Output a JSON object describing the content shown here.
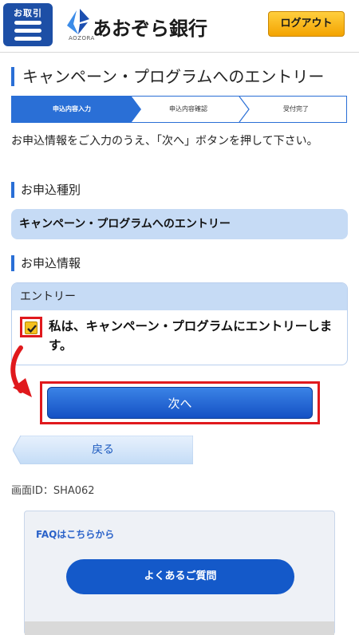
{
  "header": {
    "menu_label": "お取引",
    "bank_name": "あおぞら銀行",
    "bank_sub": "AOZORA",
    "logout_label": "ログアウト"
  },
  "page_title": "キャンペーン・プログラムへのエントリー",
  "steps": [
    "申込内容入力",
    "申込内容確認",
    "受付完了"
  ],
  "intro_text": "お申込情報をご入力のうえ、「次へ」ボタンを押して下さい。",
  "section_type": {
    "title": "お申込種別",
    "value": "キャンペーン・プログラムへのエントリー"
  },
  "section_info": {
    "title": "お申込情報",
    "card_header": "エントリー",
    "checkbox_label": "私は、キャンペーン・プログラムにエントリーします。",
    "checkbox_checked": true
  },
  "buttons": {
    "next": "次へ",
    "back": "戻る"
  },
  "screen_id": "画面ID：SHA062",
  "faq": {
    "title": "FAQはこちらから",
    "button": "よくあるご質問"
  },
  "colors": {
    "brand_blue": "#1d4fa6",
    "accent_orange": "#f3a300",
    "highlight_red": "#e0191d",
    "panel_blue": "#c6dbf5"
  }
}
